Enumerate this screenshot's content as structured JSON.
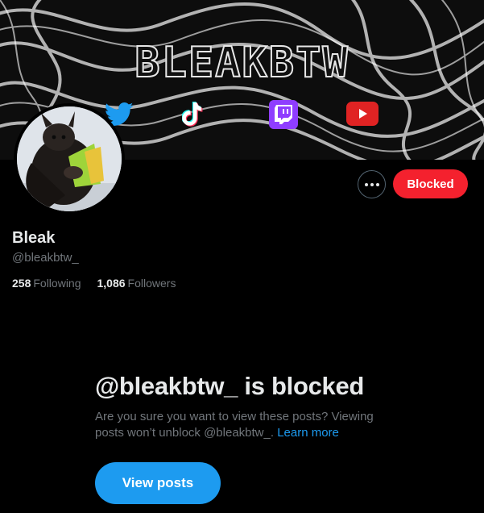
{
  "banner": {
    "title": "BLEAKBTW",
    "socials": [
      "twitter-icon",
      "tiktok-icon",
      "twitch-icon",
      "youtube-icon"
    ]
  },
  "profile": {
    "display_name": "Bleak",
    "handle": "@bleakbtw_",
    "following_count": "258",
    "following_label": "Following",
    "followers_count": "1,086",
    "followers_label": "Followers"
  },
  "actions": {
    "more_icon": "more-icon",
    "blocked_label": "Blocked"
  },
  "blocked_notice": {
    "title": "@bleakbtw_ is blocked",
    "description": "Are you sure you want to view these posts? Viewing posts won’t unblock @bleakbtw_.",
    "learn_more": "Learn more",
    "view_posts_label": "View posts"
  },
  "colors": {
    "background": "#000000",
    "blocked_button": "#f4212e",
    "accent": "#1d9bf0",
    "secondary_text": "#71767b"
  }
}
